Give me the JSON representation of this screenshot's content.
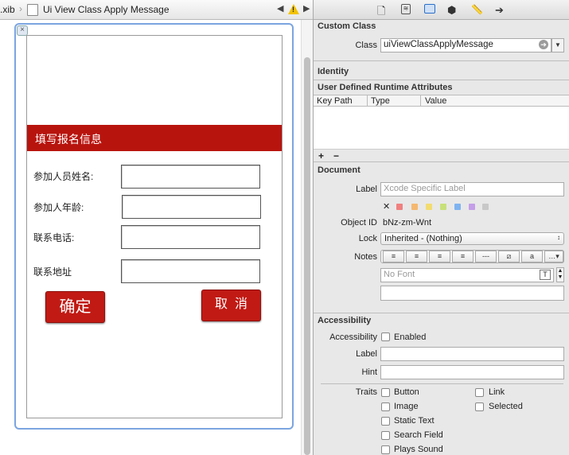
{
  "jumpbar": {
    "file_crumb": ".xib",
    "object_crumb": "Ui View Class Apply Message",
    "back_arrow": "◀",
    "warning_mark": "!",
    "forward_arrow": "▶"
  },
  "form": {
    "header": "填写报名信息",
    "name_label": "参加人员姓名:",
    "age_label": "参加人年龄:",
    "phone_label": "联系电话:",
    "address_label": "联系地址",
    "confirm_button": "确定",
    "cancel_button": "取  消"
  },
  "inspector": {
    "toolbar_icons": [
      "file-icon",
      "quick-help-icon",
      "identity-icon",
      "attributes-icon",
      "size-icon",
      "connections-icon"
    ],
    "custom_class": {
      "title": "Custom Class",
      "class_label": "Class",
      "class_value": "uiViewClassApplyMessage"
    },
    "identity": {
      "title": "Identity"
    },
    "runtime_attributes": {
      "title": "User Defined Runtime Attributes",
      "columns": [
        "Key Path",
        "Type",
        "Value"
      ],
      "add": "+",
      "remove": "−"
    },
    "document": {
      "title": "Document",
      "label_label": "Label",
      "label_placeholder": "Xcode Specific Label",
      "clear_mark": "✕",
      "swatch_colors": [
        "#f08080",
        "#f5b870",
        "#f2dc70",
        "#c8e07a",
        "#7fb3f0",
        "#c49ee8",
        "#c8c8c8"
      ],
      "object_id_label": "Object ID",
      "object_id_value": "bNz-zm-Wnt",
      "lock_label": "Lock",
      "lock_value": "Inherited - (Nothing)",
      "notes_label": "Notes",
      "font_placeholder": "No Font"
    },
    "accessibility": {
      "title": "Accessibility",
      "accessibility_label": "Accessibility",
      "enabled_label": "Enabled",
      "label_label": "Label",
      "hint_label": "Hint",
      "traits_label": "Traits",
      "traits_left": [
        "Button",
        "Image",
        "Static Text",
        "Search Field",
        "Plays Sound"
      ],
      "traits_right": [
        "Link",
        "Selected"
      ]
    }
  }
}
